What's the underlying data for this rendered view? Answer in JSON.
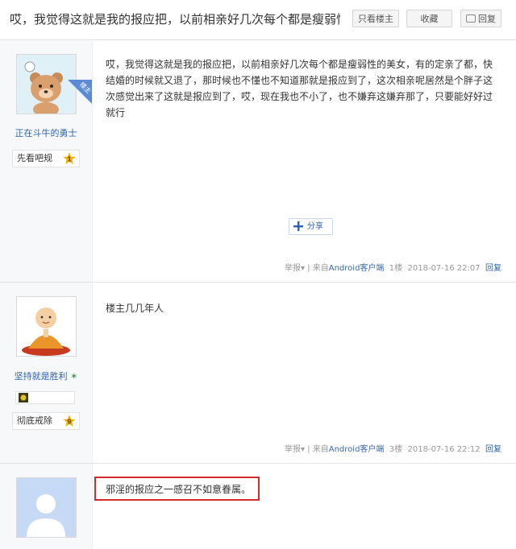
{
  "header": {
    "title": "哎，我觉得这就是我的报应把，以前相亲好几次每个都是瘦弱性...",
    "btn_only_op": "只看楼主",
    "btn_favorite": "收藏",
    "btn_reply": "回复"
  },
  "posts": [
    {
      "op_tag": "楼主",
      "username": "正在斗牛的勇士",
      "badge_name": "先看吧规",
      "level": "1",
      "content": "哎，我觉得这就是我的报应把，以前相亲好几次每个都是瘦弱性的美女，有的定亲了都，快结婚的时候就又退了，那时候也不懂也不知道那就是报应到了，这次相亲呢居然是个胖子这次感觉出来了这就是报应到了，哎，现在我也不小了，也不嫌弃这嫌弃那了，只要能好好过就行",
      "share_label": "分享",
      "report": "举报",
      "source_prefix": "来自",
      "source_app": "Android客户端",
      "floor": "1楼",
      "time": "2018-07-16 22:07",
      "reply": "回复"
    },
    {
      "username": "坚持就是胜利",
      "badge_name": "彻底戒除",
      "level": "9",
      "content": "楼主几几年人",
      "report": "举报",
      "source_prefix": "来自",
      "source_app": "Android客户端",
      "floor": "3楼",
      "time": "2018-07-16 22:12",
      "reply": "回复"
    },
    {
      "content": "邪淫的报应之一感召不如意眷属。"
    }
  ],
  "colors": {
    "link": "#2d64b3",
    "highlight_box": "#d12b2b",
    "level_badge": "#f0b400"
  }
}
